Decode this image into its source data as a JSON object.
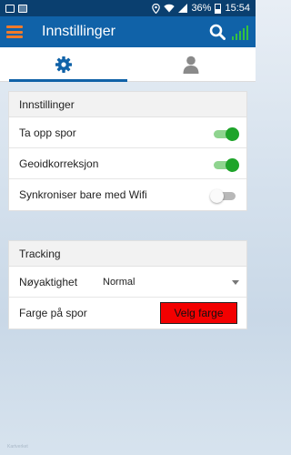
{
  "status_bar": {
    "battery_percent": "36%",
    "time": "15:54",
    "left_icons": [
      "app-icon",
      "notification-icon"
    ],
    "right_icons": [
      "location-icon",
      "wifi-icon",
      "signal-icon",
      "battery-icon"
    ]
  },
  "appbar": {
    "title": "Innstillinger",
    "icons": [
      "menu-icon",
      "search-icon",
      "gps-signal-icon"
    ],
    "accent_color": "#1062a8",
    "menu_color": "#f07a2a",
    "signal_color": "#35c23d"
  },
  "tabs": [
    {
      "name": "settings",
      "icon": "gear-icon",
      "selected": true
    },
    {
      "name": "profile",
      "icon": "user-icon",
      "selected": false
    }
  ],
  "settings_section": {
    "header": "Innstillinger",
    "items": [
      {
        "label": "Ta opp spor",
        "enabled": true
      },
      {
        "label": "Geoidkorreksjon",
        "enabled": true
      },
      {
        "label": "Synkroniser bare med Wifi",
        "enabled": false
      }
    ]
  },
  "tracking_section": {
    "header": "Tracking",
    "accuracy": {
      "label": "Nøyaktighet",
      "selected": "Normal"
    },
    "track_color": {
      "label": "Farge på spor",
      "button_label": "Velg farge",
      "color": "#f30000"
    }
  },
  "watermark": "Kartverket"
}
